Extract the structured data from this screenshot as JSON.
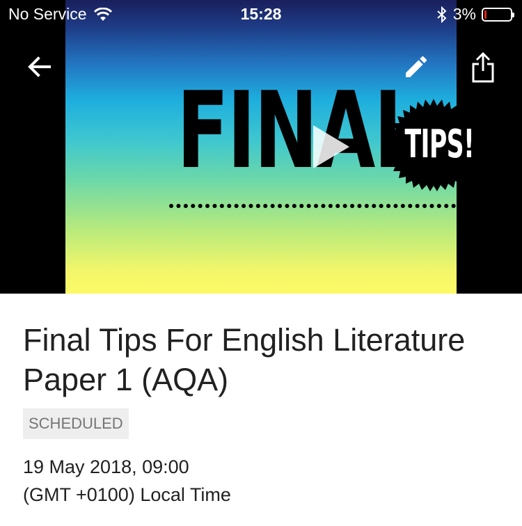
{
  "status_bar": {
    "carrier": "No Service",
    "time": "15:28",
    "battery_percent": "3%",
    "battery_level": 0.03,
    "icons": [
      "wifi-icon",
      "bluetooth-icon",
      "battery-icon"
    ]
  },
  "toolbar": {
    "icons": [
      "back-arrow-icon",
      "edit-pencil-icon",
      "share-icon"
    ]
  },
  "video": {
    "thumbnail_text": "FINAL",
    "badge_text": "TIPS!",
    "play_icon": "play-icon"
  },
  "details": {
    "title": "Final Tips For English Literature Paper 1 (AQA)",
    "status": "SCHEDULED",
    "date": "19 May 2018, 09:00",
    "timezone": "(GMT +0100) Local Time"
  },
  "colors": {
    "status_text": "#757575",
    "status_bg": "#eeeeee",
    "title_text": "#212121",
    "battery_low": "#e0241b"
  }
}
